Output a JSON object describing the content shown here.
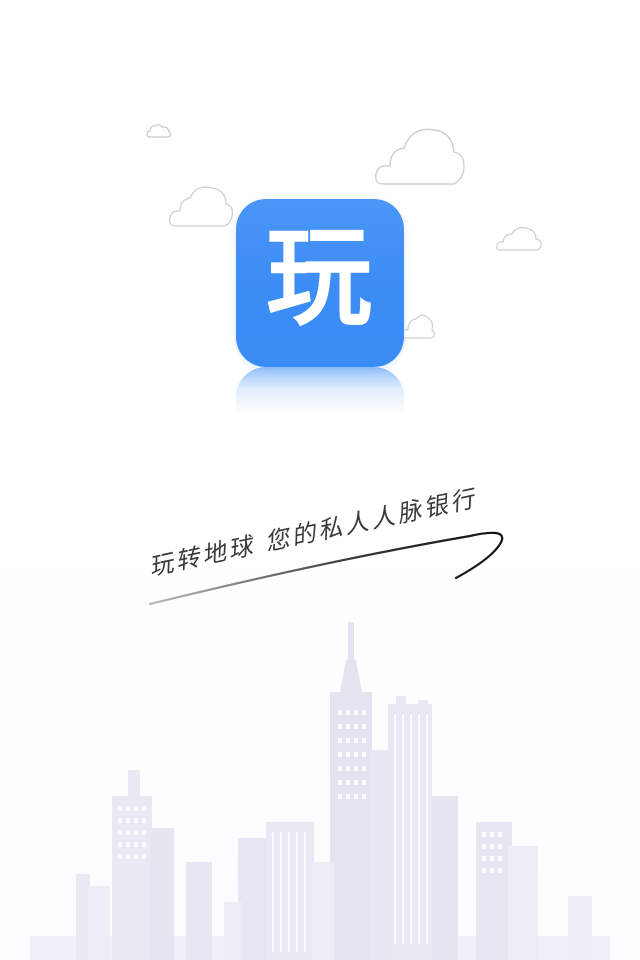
{
  "splash": {
    "app_icon": {
      "glyph": "玩",
      "color": "#3a8cf5",
      "icon_name": "wan-app-icon"
    },
    "slogan": "玩转地球  您的私人人脉银行"
  },
  "decor": {
    "cloud_color": "#c8c8c8",
    "skyline_color": "#e6e8f2"
  }
}
